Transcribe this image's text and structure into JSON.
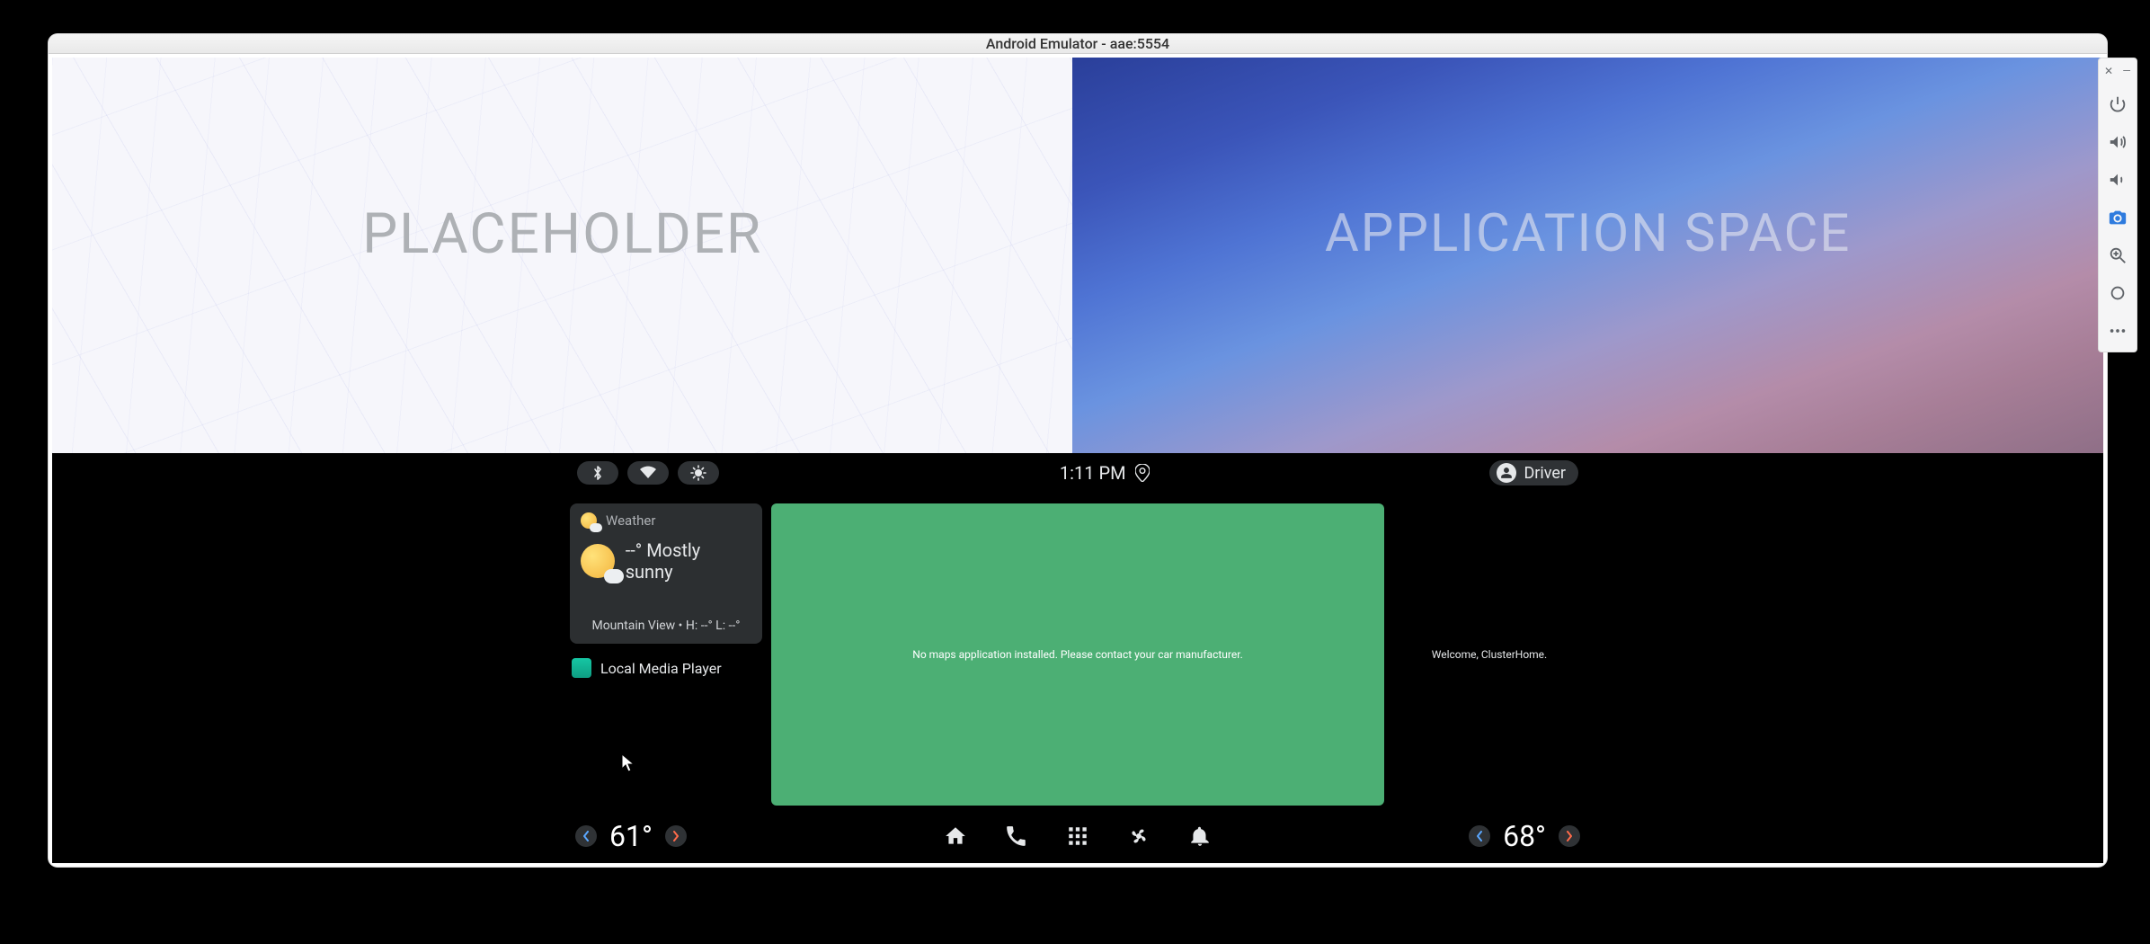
{
  "emulator": {
    "title": "Android Emulator - aae:5554"
  },
  "cluster": {
    "placeholder_label": "PLACEHOLDER",
    "application_space_label": "APPLICATION SPACE"
  },
  "statusbar": {
    "time": "1:11 PM",
    "user_label": "Driver"
  },
  "weather": {
    "header": "Weather",
    "temp": "--°",
    "condition": "Mostly sunny",
    "footer": "Mountain View • H: --° L: --°"
  },
  "media": {
    "label": "Local Media Player"
  },
  "maps": {
    "message": "No maps application installed. Please contact your car manufacturer."
  },
  "clusterhome": {
    "welcome": "Welcome, ClusterHome."
  },
  "navbar": {
    "left_temp": "61°",
    "right_temp": "68°"
  },
  "side_toolbar": {
    "items": [
      "close",
      "minimize",
      "power",
      "volume-up",
      "volume-down",
      "camera",
      "zoom",
      "circle",
      "more"
    ]
  }
}
